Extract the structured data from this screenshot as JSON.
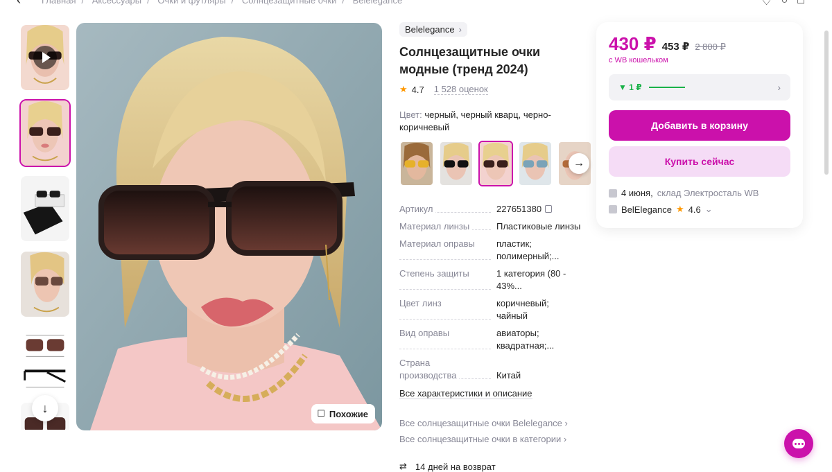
{
  "breadcrumb": {
    "items": [
      "Главная",
      "Аксессуары",
      "Очки и футляры",
      "Солнцезащитные очки",
      "Belelegance"
    ]
  },
  "gallery": {
    "thumbnails": [
      {
        "kind": "video",
        "label": "video-thumbnail"
      },
      {
        "kind": "photo",
        "label": "photo",
        "active": true
      },
      {
        "kind": "photo",
        "label": "packaging"
      },
      {
        "kind": "photo",
        "label": "profile"
      },
      {
        "kind": "photo",
        "label": "dimensions"
      },
      {
        "kind": "photo",
        "label": "product"
      }
    ],
    "similar_label": "Похожие"
  },
  "product": {
    "brand": "Belelegance",
    "title": "Солнцезащитные очки модные (тренд 2024)",
    "rating": "4.7",
    "reviews": "1 528 оценок",
    "color_label": "Цвет:",
    "color_value": "черный, черный кварц, черно-коричневый",
    "specs": [
      {
        "k": "Артикул",
        "v": "227651380"
      },
      {
        "k": "Материал линзы",
        "v": "Пластиковые линзы"
      },
      {
        "k": "Материал оправы",
        "v": "пластик; полимерный;..."
      },
      {
        "k": "Степень защиты",
        "v": "1 категория (80 - 43%..."
      },
      {
        "k": "Цвет линз",
        "v": "коричневый; чайный"
      },
      {
        "k": "Вид оправы",
        "v": "авиаторы; квадратная;..."
      },
      {
        "k": "Страна производства",
        "v": "Китай"
      }
    ],
    "all_specs_link": "Все характеристики и описание",
    "link_brand": "Все солнцезащитные очки Belelegance",
    "link_category": "Все солнцезащитные очки в категории",
    "return_policy": "14 дней на возврат"
  },
  "card": {
    "price": "430 ₽",
    "price_alt": "453 ₽",
    "price_old": "2 800 ₽",
    "wallet_note": "с WB кошельком",
    "promo": "▼ 1 ₽",
    "add_to_cart": "Добавить в корзину",
    "buy_now": "Купить сейчас",
    "delivery_date": "4 июня,",
    "delivery_warehouse": "склад Электросталь WB",
    "seller_name": "BelElegance",
    "seller_rating": "4.6"
  },
  "colors": {
    "accent": "#cb11ab",
    "accent_light": "#f5dcf6",
    "green": "#1ab248",
    "star": "#ff9800"
  }
}
